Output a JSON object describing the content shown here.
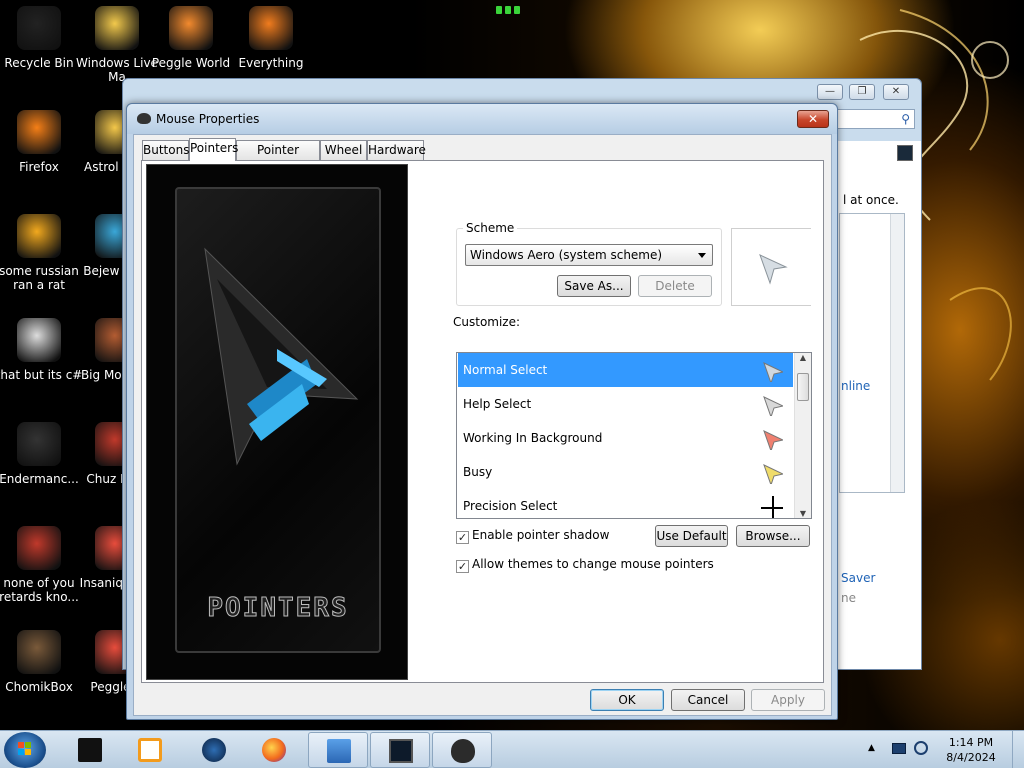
{
  "desktop": {
    "icons": [
      {
        "label": "Recycle Bin",
        "icon": "recycle-bin-icon"
      },
      {
        "label": "Windows Live Ma",
        "icon": "windows-live-icon"
      },
      {
        "label": "Peggle World",
        "icon": "peggle-icon"
      },
      {
        "label": "Everything",
        "icon": "everything-icon"
      },
      {
        "label": "Firefox",
        "icon": "firefox-icon"
      },
      {
        "label": "Astrol Delu",
        "icon": "app-icon"
      },
      {
        "label": "some russian ran a rat",
        "icon": "file-icon"
      },
      {
        "label": "Bejew Delu",
        "icon": "app-icon"
      },
      {
        "label": "that but its c#",
        "icon": "shortcut-icon"
      },
      {
        "label": "Big Mo Delu",
        "icon": "app-icon"
      },
      {
        "label": "Endermanc...",
        "icon": "app-icon"
      },
      {
        "label": "Chuz Delu",
        "icon": "app-icon"
      },
      {
        "label": "none of you retards kno...",
        "icon": "app-icon"
      },
      {
        "label": "Insaniq Delu",
        "icon": "app-icon"
      },
      {
        "label": "ChomikBox",
        "icon": "chomikbox-icon"
      },
      {
        "label": "Peggle D",
        "icon": "peggle-icon"
      }
    ]
  },
  "background_window": {
    "search_placeholder": "",
    "text_at_once": "l at once.",
    "text_online": "nline",
    "text_saver": "Saver",
    "text_ne": "ne",
    "controls": [
      "—",
      "❐",
      "✕"
    ]
  },
  "dialog": {
    "title": "Mouse Properties",
    "close_label": "✕",
    "tabs": [
      {
        "label": "Buttons",
        "active": false
      },
      {
        "label": "Pointers",
        "active": true
      },
      {
        "label": "Pointer Options",
        "active": false
      },
      {
        "label": "Wheel",
        "active": false
      },
      {
        "label": "Hardware",
        "active": false
      }
    ],
    "banner_word": "POINTERS",
    "scheme": {
      "caption": "Scheme",
      "value": "Windows Aero (system scheme)",
      "save_as": "Save As...",
      "delete": "Delete"
    },
    "customize_label": "Customize:",
    "pointers": [
      {
        "name": "Normal Select",
        "selected": true,
        "cursor_color": "#cfd8e0"
      },
      {
        "name": "Help Select",
        "selected": false,
        "cursor_color": "#d8d8d8"
      },
      {
        "name": "Working In Background",
        "selected": false,
        "cursor_color": "#f08070"
      },
      {
        "name": "Busy",
        "selected": false,
        "cursor_color": "#f0dc6a"
      },
      {
        "name": "Precision Select",
        "selected": false,
        "cursor_color": "#000000"
      }
    ],
    "enable_shadow": {
      "label": "Enable pointer shadow",
      "checked": true
    },
    "allow_themes": {
      "label": "Allow themes to change mouse pointers",
      "checked": true
    },
    "use_default": "Use Default",
    "browse": "Browse...",
    "ok": "OK",
    "cancel": "Cancel",
    "apply": "Apply"
  },
  "taskbar": {
    "time": "1:14 PM",
    "date": "8/4/2024"
  },
  "colors": {
    "selection": "#3399ff",
    "dialog_frame": "#bfd3e8",
    "close_red": "#c8462b"
  }
}
